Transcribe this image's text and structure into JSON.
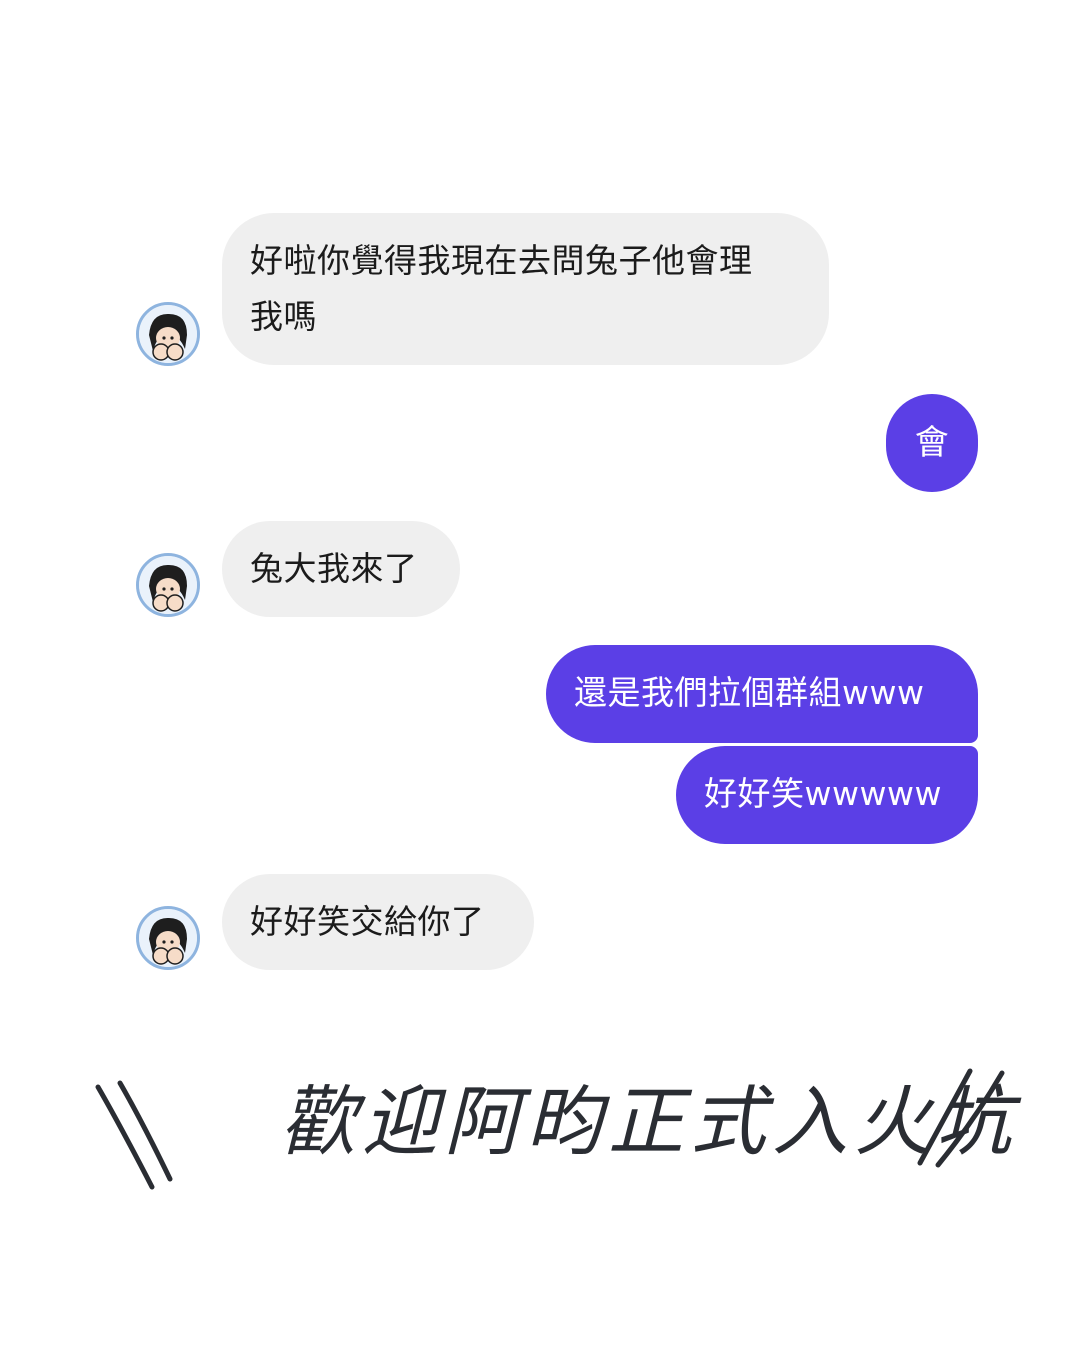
{
  "messages": [
    {
      "side": "in",
      "text": "好啦你覺得我現在去問兔子他會理\n我嗎"
    },
    {
      "side": "out",
      "text": "會"
    },
    {
      "side": "in",
      "text": "兔大我來了"
    },
    {
      "side": "out",
      "text": "還是我們拉個群組www"
    },
    {
      "side": "out",
      "text": "好好笑wwwww"
    },
    {
      "side": "in",
      "text": "好好笑交給你了"
    }
  ],
  "banner": {
    "text": "歡迎阿昀正式入火坑"
  },
  "icons": {
    "avatar": "girl-avatar-icon",
    "left_slashes": "double-backslash-decoration",
    "right_slashes": "double-slash-decoration"
  },
  "colors": {
    "incoming_bubble": "#efefef",
    "outgoing_bubble": "#5b3fe6",
    "banner_text": "#2a2d33"
  }
}
